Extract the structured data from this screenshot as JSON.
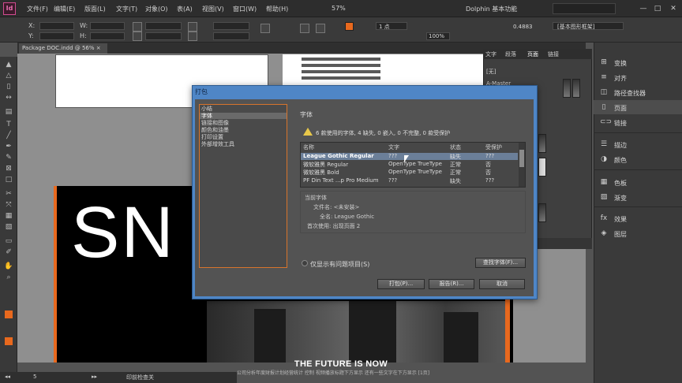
{
  "app": {
    "logo_text": "Id"
  },
  "menu": {
    "items": [
      "文件(F)",
      "编辑(E)",
      "版面(L)",
      "文字(T)",
      "对象(O)",
      "表(A)",
      "视图(V)",
      "窗口(W)",
      "帮助(H)"
    ],
    "zoom": "57%",
    "workspace": "Dolphin  基本功能"
  },
  "control": {
    "x_label": "X:",
    "y_label": "Y:",
    "w_label": "W:",
    "h_label": "H:",
    "stroke_weight": "1 点",
    "opacity": "100%",
    "stroke_value": "0.4883",
    "frame_label": "[基本图形框架]"
  },
  "document": {
    "tab_label": "Package DOC.indd @ 56% ×"
  },
  "canvas": {
    "headline": "SN",
    "caption": "THE FUTURE IS NOW",
    "sub_caption": "公司分析年度财报计划经营统计  控制  视频播放标题下方显示  还有一些文字在下方显示  [1页]"
  },
  "status": {
    "page": "5",
    "preflight": "印前检查关"
  },
  "pages_panel": {
    "tabs": [
      "文字",
      "段落",
      "页面",
      "链接"
    ],
    "master_none": "[无]",
    "master_a": "A-Master"
  },
  "dock": {
    "items": [
      "变换",
      "对齐",
      "路径查找器",
      "页面",
      "链接",
      "描边",
      "颜色",
      "色板",
      "渐变",
      "效果",
      "图层"
    ]
  },
  "dialog": {
    "title": "打包",
    "categories": [
      "小结",
      "字体",
      "链接和图像",
      "颜色和油墨",
      "打印设置",
      "外部增效工具"
    ],
    "selected_category": 1,
    "section_title": "字体",
    "warning": "6 款使用的字体, 4 缺失, 0 嵌入, 0 不完整, 0 款受保护",
    "columns": [
      "名称",
      "文字",
      "状态",
      "受保护"
    ],
    "rows": [
      {
        "name": "League Gothic Regular",
        "type": "???",
        "status": "缺失",
        "protected": "???"
      },
      {
        "name": "微软雅黑 Regular",
        "type": "OpenType TrueType",
        "status": "正常",
        "protected": "否"
      },
      {
        "name": "微软雅黑 Bold",
        "type": "OpenType TrueType",
        "status": "正常",
        "protected": "否"
      },
      {
        "name": "PF Din Text ...p Pro Medium",
        "type": "???",
        "status": "缺失",
        "protected": "???"
      }
    ],
    "current_font": {
      "heading": "当前字体",
      "file_label": "文件名: <未安装>",
      "full_name": "全名: League Gothic",
      "first_used": "首次使用: 出现页面 2"
    },
    "show_problems_only": "仅显示有问题项目(S)",
    "find_font": "查找字体(F)...",
    "buttons": {
      "package": "打包(P)...",
      "report": "报告(R)...",
      "cancel": "取消"
    }
  },
  "colors": {
    "accent": "#e8691e",
    "dialog_frame": "#4f86c6",
    "warning": "#e8c84a"
  }
}
